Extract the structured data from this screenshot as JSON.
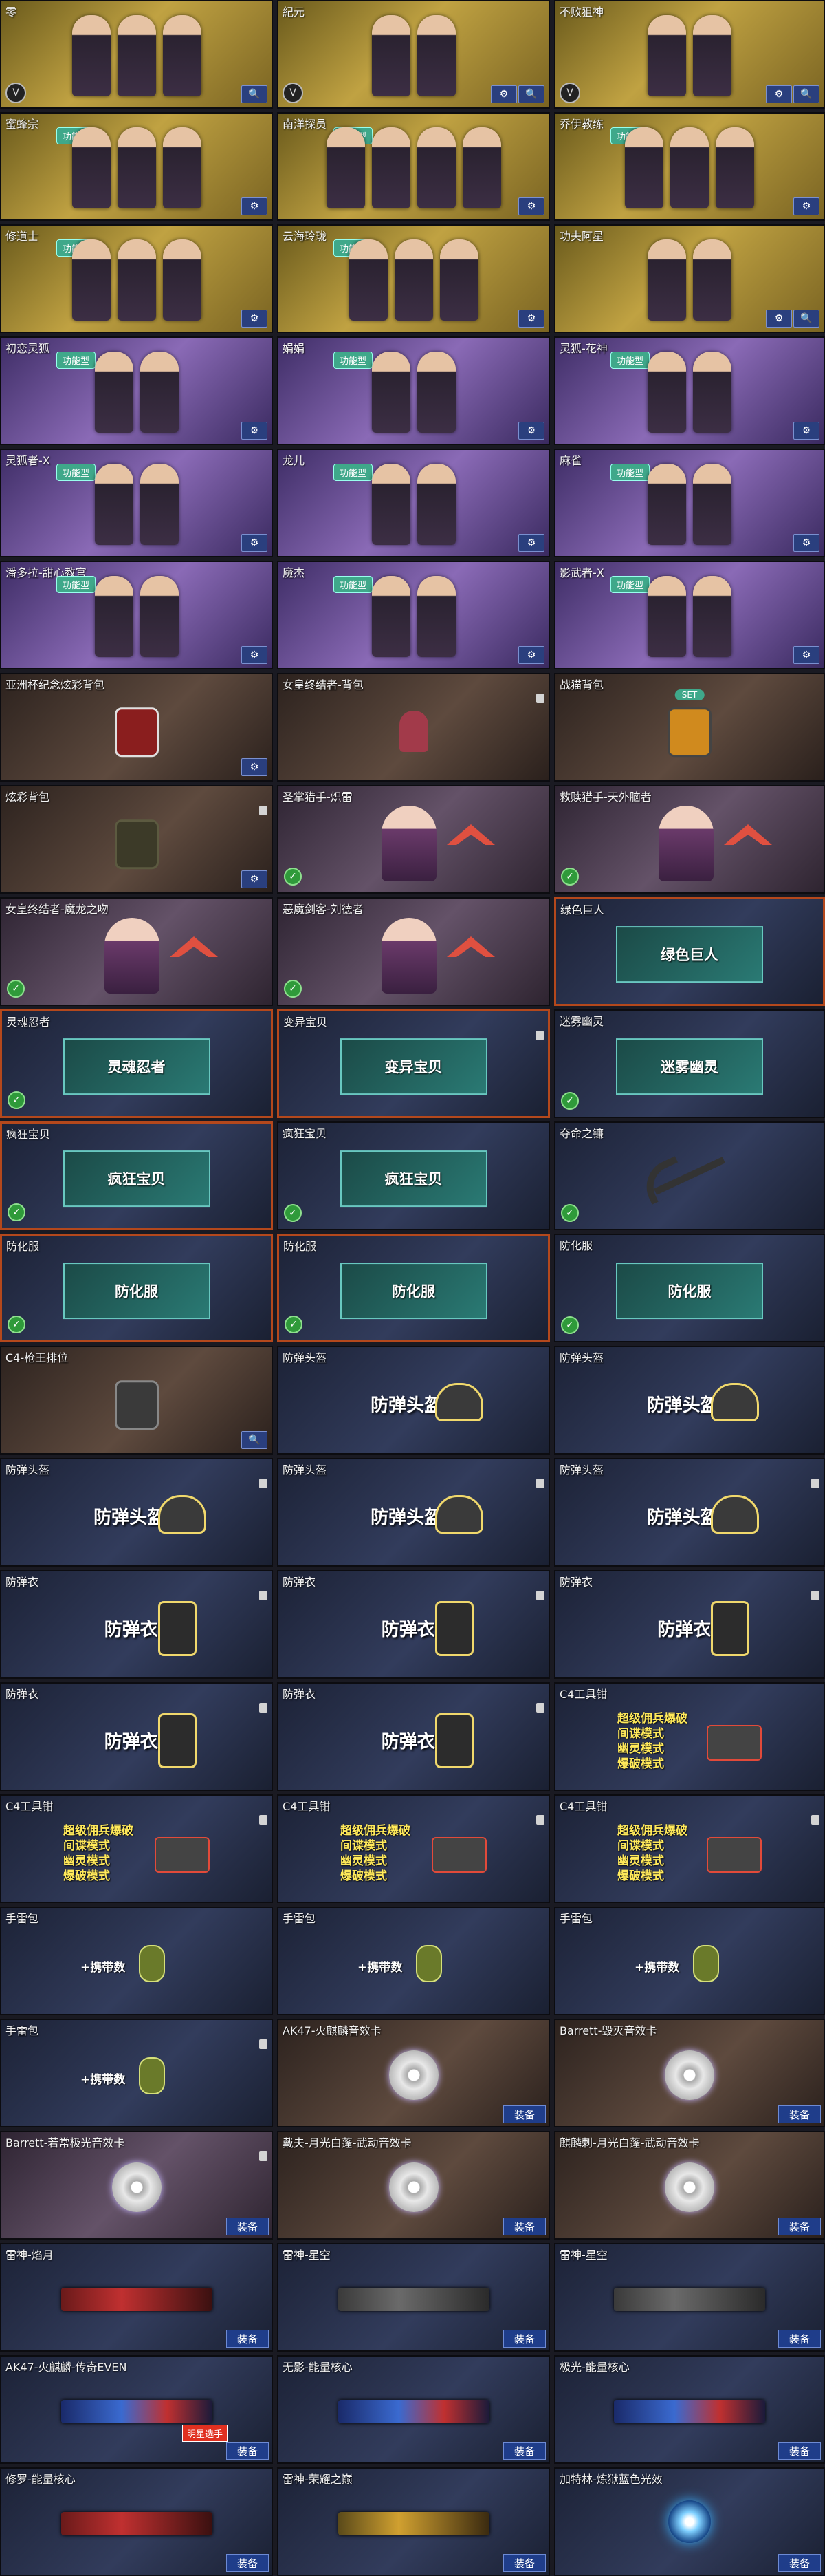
{
  "equip_label": "装备",
  "gold_badge": "功能型",
  "set_badge": "SET",
  "cards": [
    {
      "title": "零",
      "theme": "gold",
      "kind": "chars",
      "n": 3,
      "badge": false,
      "ring": true,
      "buttons": [
        "search"
      ]
    },
    {
      "title": "紀元",
      "theme": "gold",
      "kind": "chars",
      "n": 2,
      "badge": false,
      "ring": true,
      "buttons": [
        "gear",
        "search"
      ]
    },
    {
      "title": "不败狙神",
      "theme": "gold",
      "kind": "chars",
      "n": 2,
      "badge": false,
      "ring": true,
      "buttons": [
        "gear",
        "search"
      ]
    },
    {
      "title": "蜜蜂宗",
      "theme": "gold",
      "kind": "chars",
      "n": 3,
      "badge": true,
      "buttons": [
        "gear"
      ]
    },
    {
      "title": "南洋探员",
      "theme": "gold",
      "kind": "chars",
      "n": 4,
      "badge": true,
      "buttons": [
        "gear"
      ]
    },
    {
      "title": "乔伊教练",
      "theme": "gold",
      "kind": "chars",
      "n": 3,
      "badge": true,
      "buttons": [
        "gear"
      ]
    },
    {
      "title": "修道士",
      "theme": "gold",
      "kind": "chars",
      "n": 3,
      "badge": true,
      "buttons": [
        "gear"
      ]
    },
    {
      "title": "云海玲珑",
      "theme": "gold",
      "kind": "chars",
      "n": 3,
      "badge": true,
      "buttons": [
        "gear"
      ]
    },
    {
      "title": "功夫阿星",
      "theme": "gold",
      "kind": "chars",
      "n": 2,
      "badge": false,
      "buttons": [
        "gear",
        "search"
      ]
    },
    {
      "title": "初恋灵狐",
      "theme": "purple",
      "kind": "chars",
      "n": 2,
      "badge": true,
      "buttons": [
        "gear"
      ]
    },
    {
      "title": "娟娟",
      "theme": "purple",
      "kind": "chars",
      "n": 2,
      "badge": true,
      "buttons": [
        "gear"
      ]
    },
    {
      "title": "灵狐-花神",
      "theme": "purple",
      "kind": "chars",
      "n": 2,
      "badge": true,
      "buttons": [
        "gear"
      ]
    },
    {
      "title": "灵狐者-X",
      "theme": "purple",
      "kind": "chars",
      "n": 2,
      "badge": true,
      "buttons": [
        "gear"
      ]
    },
    {
      "title": "龙儿",
      "theme": "purple",
      "kind": "chars",
      "n": 2,
      "badge": true,
      "buttons": [
        "gear"
      ]
    },
    {
      "title": "麻雀",
      "theme": "purple",
      "kind": "chars",
      "n": 2,
      "badge": true,
      "buttons": [
        "gear"
      ]
    },
    {
      "title": "潘多拉-甜心教官",
      "theme": "purple",
      "kind": "chars",
      "n": 2,
      "badge": true,
      "buttons": [
        "gear"
      ]
    },
    {
      "title": "魔杰",
      "theme": "purple",
      "kind": "chars",
      "n": 2,
      "badge": true,
      "buttons": [
        "gear"
      ]
    },
    {
      "title": "影武者-X",
      "theme": "purple",
      "kind": "chars",
      "n": 2,
      "badge": true,
      "buttons": [
        "gear"
      ]
    },
    {
      "title": "亚洲杯纪念炫彩背包",
      "theme": "brown",
      "kind": "bag",
      "variant": "",
      "buttons": [
        "gear"
      ]
    },
    {
      "title": "女皇终结者-背包",
      "theme": "brown",
      "kind": "doll",
      "lock": true
    },
    {
      "title": "战猫背包",
      "theme": "brown",
      "kind": "bag",
      "variant": "orange",
      "set": true
    },
    {
      "title": "炫彩背包",
      "theme": "brown",
      "kind": "bag",
      "variant": "dark",
      "lock": true,
      "buttons": [
        "gear"
      ]
    },
    {
      "title": "圣掌猎手-炽雷",
      "theme": "mauve",
      "kind": "portrait",
      "check": true
    },
    {
      "title": "救赎猎手-天外脑者",
      "theme": "mauve",
      "kind": "portrait",
      "check": true
    },
    {
      "title": "女皇终结者-魔龙之吻",
      "theme": "mauve",
      "kind": "portrait",
      "check": true
    },
    {
      "title": "恶魔剑客-刘德者",
      "theme": "mauve",
      "kind": "portrait",
      "check": true
    },
    {
      "title": "绿色巨人",
      "theme": "dblue",
      "kind": "pill",
      "pill": "绿色巨人",
      "sel": true
    },
    {
      "title": "灵魂忍者",
      "theme": "dblue",
      "kind": "pill",
      "pill": "灵魂忍者",
      "check": true,
      "sel": true
    },
    {
      "title": "变异宝贝",
      "theme": "dblue",
      "kind": "pill",
      "pill": "变异宝贝",
      "lock": true,
      "sel": true
    },
    {
      "title": "迷雾幽灵",
      "theme": "dblue",
      "kind": "pill",
      "pill": "迷雾幽灵",
      "check": true
    },
    {
      "title": "疯狂宝贝",
      "theme": "dblue",
      "kind": "pill",
      "pill": "疯狂宝贝",
      "check": true,
      "sel": true
    },
    {
      "title": "疯狂宝贝",
      "theme": "dblue",
      "kind": "pill",
      "pill": "疯狂宝贝",
      "check": true
    },
    {
      "title": "夺命之镰",
      "theme": "dblue",
      "kind": "scythe",
      "check": true
    },
    {
      "title": "防化服",
      "theme": "dblue",
      "kind": "pill",
      "pill": "防化服",
      "check": true,
      "sel": true
    },
    {
      "title": "防化服",
      "theme": "dblue",
      "kind": "pill",
      "pill": "防化服",
      "check": true,
      "sel": true
    },
    {
      "title": "防化服",
      "theme": "dblue",
      "kind": "pill",
      "pill": "防化服",
      "check": true
    },
    {
      "title": "C4-枪王排位",
      "theme": "brown",
      "kind": "bag",
      "variant": "c4",
      "buttons": [
        "search"
      ]
    },
    {
      "title": "防弹头盔",
      "theme": "dblue",
      "kind": "helmet",
      "text": "防弹头盔"
    },
    {
      "title": "防弹头盔",
      "theme": "dblue",
      "kind": "helmet",
      "text": "防弹头盔"
    },
    {
      "title": "防弹头盔",
      "theme": "dblue",
      "kind": "helmet",
      "text": "防弹头盔",
      "lock": true
    },
    {
      "title": "防弹头盔",
      "theme": "dblue",
      "kind": "helmet",
      "text": "防弹头盔",
      "lock": true
    },
    {
      "title": "防弹头盔",
      "theme": "dblue",
      "kind": "helmet",
      "text": "防弹头盔",
      "lock": true
    },
    {
      "title": "防弹衣",
      "theme": "dblue",
      "kind": "vest",
      "text": "防弹衣",
      "lock": true
    },
    {
      "title": "防弹衣",
      "theme": "dblue",
      "kind": "vest",
      "text": "防弹衣",
      "lock": true
    },
    {
      "title": "防弹衣",
      "theme": "dblue",
      "kind": "vest",
      "text": "防弹衣",
      "lock": true
    },
    {
      "title": "防弹衣",
      "theme": "dblue",
      "kind": "vest",
      "text": "防弹衣",
      "lock": true
    },
    {
      "title": "防弹衣",
      "theme": "dblue",
      "kind": "vest",
      "text": "防弹衣",
      "lock": true
    },
    {
      "title": "C4工具钳",
      "theme": "dblue",
      "kind": "c4",
      "lines": [
        "超级佣兵爆破",
        "间谍模式",
        "幽灵模式",
        "爆破模式"
      ]
    },
    {
      "title": "C4工具钳",
      "theme": "dblue",
      "kind": "c4",
      "lines": [
        "超级佣兵爆破",
        "间谍模式",
        "幽灵模式",
        "爆破模式"
      ],
      "lock": true
    },
    {
      "title": "C4工具钳",
      "theme": "dblue",
      "kind": "c4",
      "lines": [
        "超级佣兵爆破",
        "间谍模式",
        "幽灵模式",
        "爆破模式"
      ],
      "lock": true
    },
    {
      "title": "C4工具钳",
      "theme": "dblue",
      "kind": "c4",
      "lines": [
        "超级佣兵爆破",
        "间谍模式",
        "幽灵模式",
        "爆破模式"
      ],
      "lock": true
    },
    {
      "title": "手雷包",
      "theme": "dblue",
      "kind": "gren",
      "text": "+携带数"
    },
    {
      "title": "手雷包",
      "theme": "dblue",
      "kind": "gren",
      "text": "+携带数"
    },
    {
      "title": "手雷包",
      "theme": "dblue",
      "kind": "gren",
      "text": "+携带数"
    },
    {
      "title": "手雷包",
      "theme": "dblue",
      "kind": "gren",
      "text": "+携带数",
      "lock": true
    },
    {
      "title": "AK47-火麒麟音效卡",
      "theme": "brown",
      "kind": "disc",
      "equip": true
    },
    {
      "title": "Barrett-毁灭音效卡",
      "theme": "brown",
      "kind": "disc",
      "equip": true
    },
    {
      "title": "Barrett-若常极光音效卡",
      "theme": "mauve",
      "kind": "disc",
      "equip": true,
      "lock": true
    },
    {
      "title": "戴夫-月光白蓬-武动音效卡",
      "theme": "brown",
      "kind": "disc",
      "equip": true
    },
    {
      "title": "麒麟刺-月光白蓬-武动音效卡",
      "theme": "brown",
      "kind": "disc",
      "equip": true
    },
    {
      "title": "雷神-焰月",
      "theme": "dblue",
      "kind": "gun",
      "gun": "red",
      "equip": true
    },
    {
      "title": "雷神-星空",
      "theme": "dblue",
      "kind": "gun",
      "gun": "",
      "equip": true
    },
    {
      "title": "雷神-星空",
      "theme": "dblue",
      "kind": "gun",
      "gun": "",
      "equip": true
    },
    {
      "title": "AK47-火麒麟-传奇EVEN",
      "theme": "dblue",
      "kind": "gun",
      "gun": "blue",
      "equip": true,
      "label": "明星选手"
    },
    {
      "title": "无影-能量核心",
      "theme": "dblue",
      "kind": "gun",
      "gun": "blue",
      "equip": true
    },
    {
      "title": "极光-能量核心",
      "theme": "dblue",
      "kind": "gun",
      "gun": "blue",
      "equip": true
    },
    {
      "title": "修罗-能量核心",
      "theme": "dblue",
      "kind": "gun",
      "gun": "red",
      "equip": true
    },
    {
      "title": "雷神-荣耀之巅",
      "theme": "dblue",
      "kind": "gun",
      "gun": "gold",
      "equip": true
    },
    {
      "title": "加特林-炼狱蓝色光效",
      "theme": "dblue",
      "kind": "orb",
      "equip": true
    }
  ]
}
